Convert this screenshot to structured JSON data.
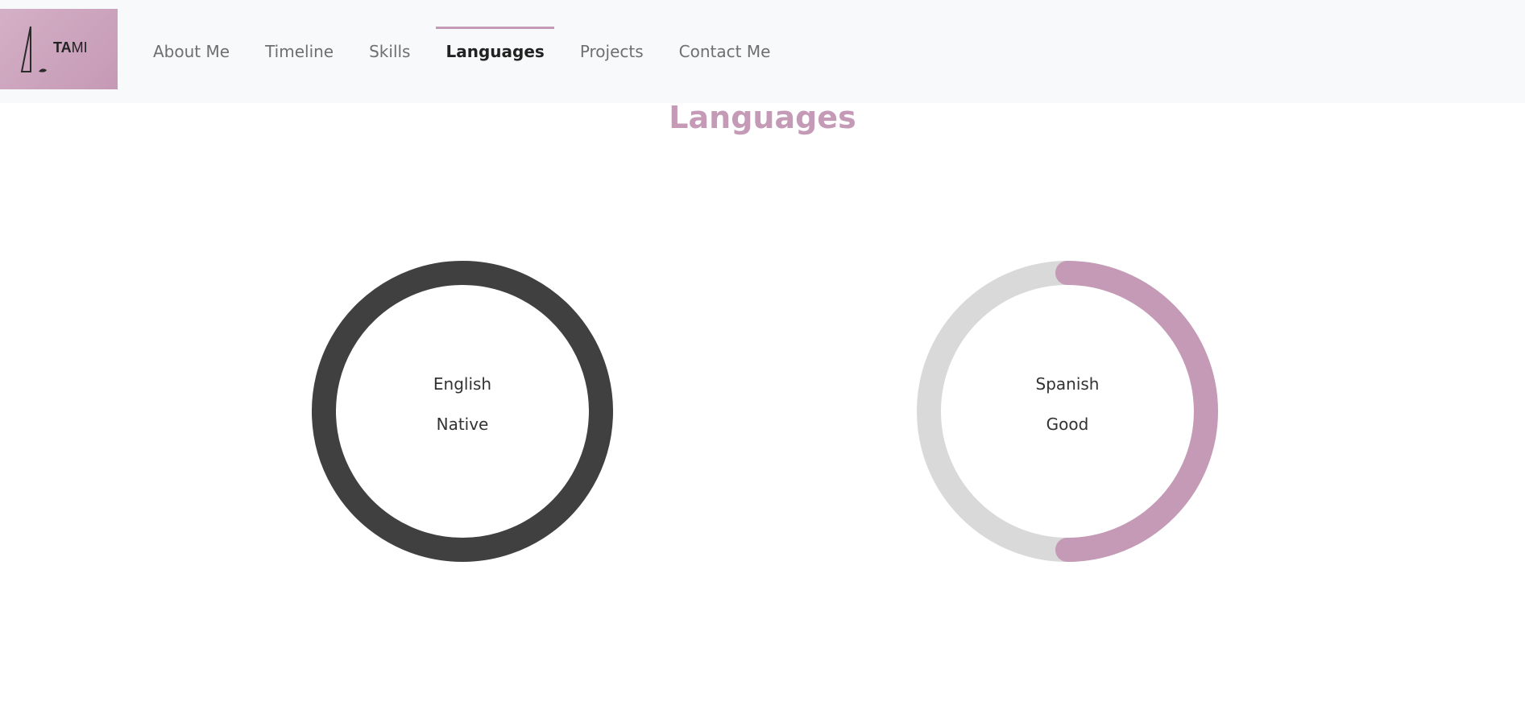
{
  "brand": {
    "logo_text_bold": "TA",
    "logo_text_light": "MI",
    "logo_bg": "#cda5be"
  },
  "nav": {
    "items": [
      {
        "label": "About Me",
        "active": false
      },
      {
        "label": "Timeline",
        "active": false
      },
      {
        "label": "Skills",
        "active": false
      },
      {
        "label": "Languages",
        "active": true
      },
      {
        "label": "Projects",
        "active": false
      },
      {
        "label": "Contact Me",
        "active": false
      }
    ]
  },
  "section": {
    "title": "Languages"
  },
  "languages": [
    {
      "name": "English",
      "level": "Native",
      "progress": 1.0,
      "color": "#404040",
      "track_color": "#d9d9d9"
    },
    {
      "name": "Spanish",
      "level": "Good",
      "progress": 0.5,
      "color": "#c49ab6",
      "track_color": "#d9d9d9"
    }
  ],
  "colors": {
    "accent": "#c49ab6",
    "nav_bg": "#f8f9fa",
    "text_muted": "#6f6f6f",
    "text_active": "#222222"
  }
}
